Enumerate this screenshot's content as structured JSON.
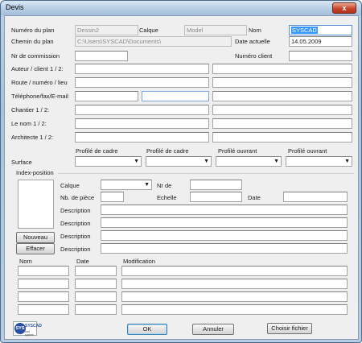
{
  "window": {
    "title": "Devis",
    "close_glyph": "x"
  },
  "plan": {
    "numero_label": "Numéro du plan",
    "numero_value": "Dessin2",
    "calque_label": "Calque",
    "calque_value": "Model",
    "nom_label": "Nom",
    "nom_value": "SYSCAD",
    "chemin_label": "Chemin du plan",
    "chemin_value": "C:\\Users\\SYSCAD\\Documents\\",
    "date_label": "Date actuelle",
    "date_value": "14.05.2009",
    "commission_label": "Nr de commission",
    "commission_value": "",
    "client_label": "Numéro client",
    "client_value": ""
  },
  "contacts": {
    "auteur_label": "Auteur / client 1 / 2:",
    "route_label": "Route / numéro / lieu",
    "tel_label": "Téléphone/fax/E-mail",
    "chantier_label": "Chantier 1 / 2:",
    "lenom_label": "Le nom 1 / 2:",
    "architecte_label": "Architecte 1 / 2:"
  },
  "surface": {
    "label": "Surface",
    "cols": [
      "Profilé de cadre",
      "Profilé de cadre",
      "Profilé ouvrant",
      "Profilé ouvrant"
    ]
  },
  "index": {
    "section_label": "Index-position",
    "calque_label": "Calque",
    "nr_label": "Nr de",
    "pieces_label": "Nb. de pièce",
    "echelle_label": "Echelle",
    "date_label": "Date",
    "description_label": "Description",
    "nouveau_button": "Nouveau",
    "effacer_button": "Effacer"
  },
  "history": {
    "nom_header": "Nom",
    "date_header": "Date",
    "modification_header": "Modification"
  },
  "footer": {
    "ok_button": "OK",
    "annuler_button": "Annuler",
    "choisir_button": "Choisir fichier",
    "logo_text": "SYSCAD",
    "logo_sub": "cad system"
  },
  "icons": {
    "dropdown": "chevron-down-icon",
    "close": "close-icon"
  },
  "colors": {
    "selection": "#3399ff",
    "close_button": "#c9452a",
    "logo": "#2a4fa3"
  }
}
